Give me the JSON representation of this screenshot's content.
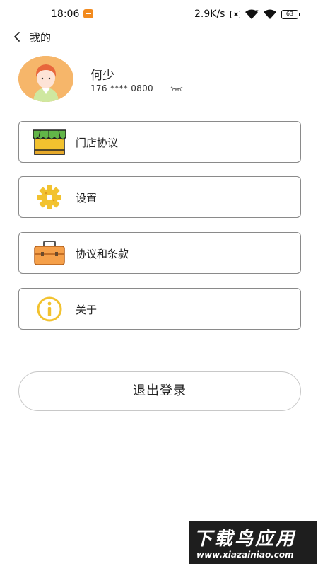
{
  "status_bar": {
    "time": "18:06",
    "net_speed": "2.9K/s",
    "battery": "63"
  },
  "header": {
    "title": "我的"
  },
  "profile": {
    "name": "何少",
    "phone": "176 **** 0800"
  },
  "menu": {
    "items": [
      {
        "label": "门店协议",
        "icon": "store-icon"
      },
      {
        "label": "设置",
        "icon": "gear-icon"
      },
      {
        "label": "协议和条款",
        "icon": "briefcase-icon"
      },
      {
        "label": "关于",
        "icon": "info-icon"
      }
    ]
  },
  "logout": {
    "label": "退出登录"
  },
  "watermark": {
    "main": "下载鸟应用",
    "url": "www.xiazainiao.com"
  },
  "colors": {
    "accent_orange": "#f6b66a",
    "icon_yellow": "#f2c22f",
    "border": "#8a8a8a"
  }
}
